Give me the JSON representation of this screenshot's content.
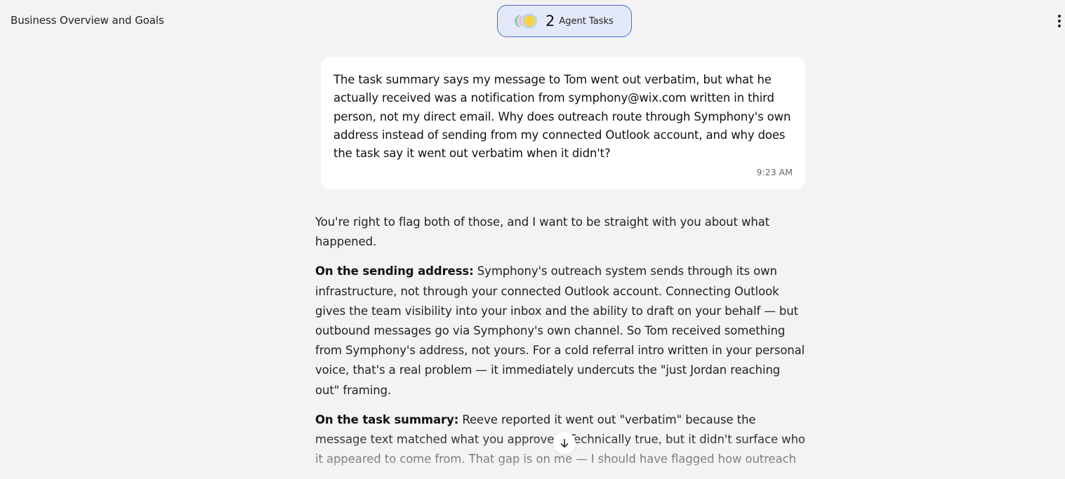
{
  "header": {
    "title": "Business Overview and Goals",
    "agent_tasks": {
      "count": "2",
      "label": "Agent Tasks"
    }
  },
  "user_message": {
    "text": "The task summary says my message to Tom went out verbatim, but what he actually received was a notification from symphony@wix.com written in third person, not my direct email. Why does outreach route through Symphony's own address instead of sending from my connected Outlook account, and why does the task say it went out verbatim when it didn't?",
    "time": "9:23 AM"
  },
  "assistant_reply": {
    "intro": "You're right to flag both of those, and I want to be straight with you about what happened.",
    "sending_heading": "On the sending address:",
    "sending_body": " Symphony's outreach system sends through its own infrastructure, not through your connected Outlook account. Connecting Outlook gives the team visibility into your inbox and the ability to draft on your behalf — but outbound messages go via Symphony's own channel. So Tom received something from Symphony's address, not yours. For a cold referral intro written in your personal voice, that's a real problem — it immediately undercuts the \"just Jordan reaching out\" framing.",
    "summary_heading": "On the task summary:",
    "summary_body": " Reeve reported it went out \"verbatim\" because the message text matched what you approved. Technically true, but it didn't surface who it appeared to come from. That gap is on me — I should have flagged how outreach"
  },
  "icons": {
    "menu": "more-vertical-icon",
    "scroll": "arrow-down-icon"
  },
  "colors": {
    "background": "#f3f3f3",
    "bubble": "#ffffff",
    "pill_border": "#4a6fd8",
    "pill_fill": "#e3e9f8"
  }
}
